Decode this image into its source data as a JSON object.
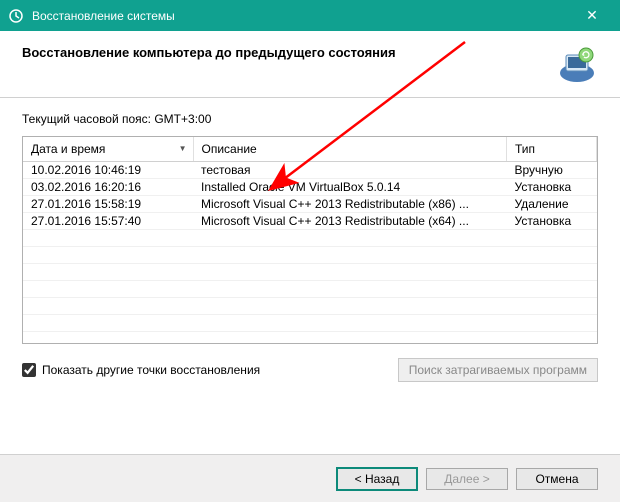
{
  "window": {
    "title": "Восстановление системы",
    "close_glyph": "✕"
  },
  "header": {
    "heading": "Восстановление компьютера до предыдущего состояния"
  },
  "timezone_label": "Текущий часовой пояс: GMT+3:00",
  "columns": {
    "date": "Дата и время",
    "desc": "Описание",
    "type": "Тип"
  },
  "rows": [
    {
      "date": "10.02.2016 10:46:19",
      "desc": "тестовая",
      "type": "Вручную"
    },
    {
      "date": "03.02.2016 16:20:16",
      "desc": "Installed Oracle VM VirtualBox 5.0.14",
      "type": "Установка"
    },
    {
      "date": "27.01.2016 15:58:19",
      "desc": "Microsoft Visual C++ 2013 Redistributable (x86) ...",
      "type": "Удаление"
    },
    {
      "date": "27.01.2016 15:57:40",
      "desc": "Microsoft Visual C++ 2013 Redistributable (x64) ...",
      "type": "Установка"
    }
  ],
  "checkbox": {
    "label": "Показать другие точки восстановления",
    "checked": true
  },
  "buttons": {
    "scan": "Поиск затрагиваемых программ",
    "back": "< Назад",
    "next": "Далее >",
    "cancel": "Отмена"
  }
}
